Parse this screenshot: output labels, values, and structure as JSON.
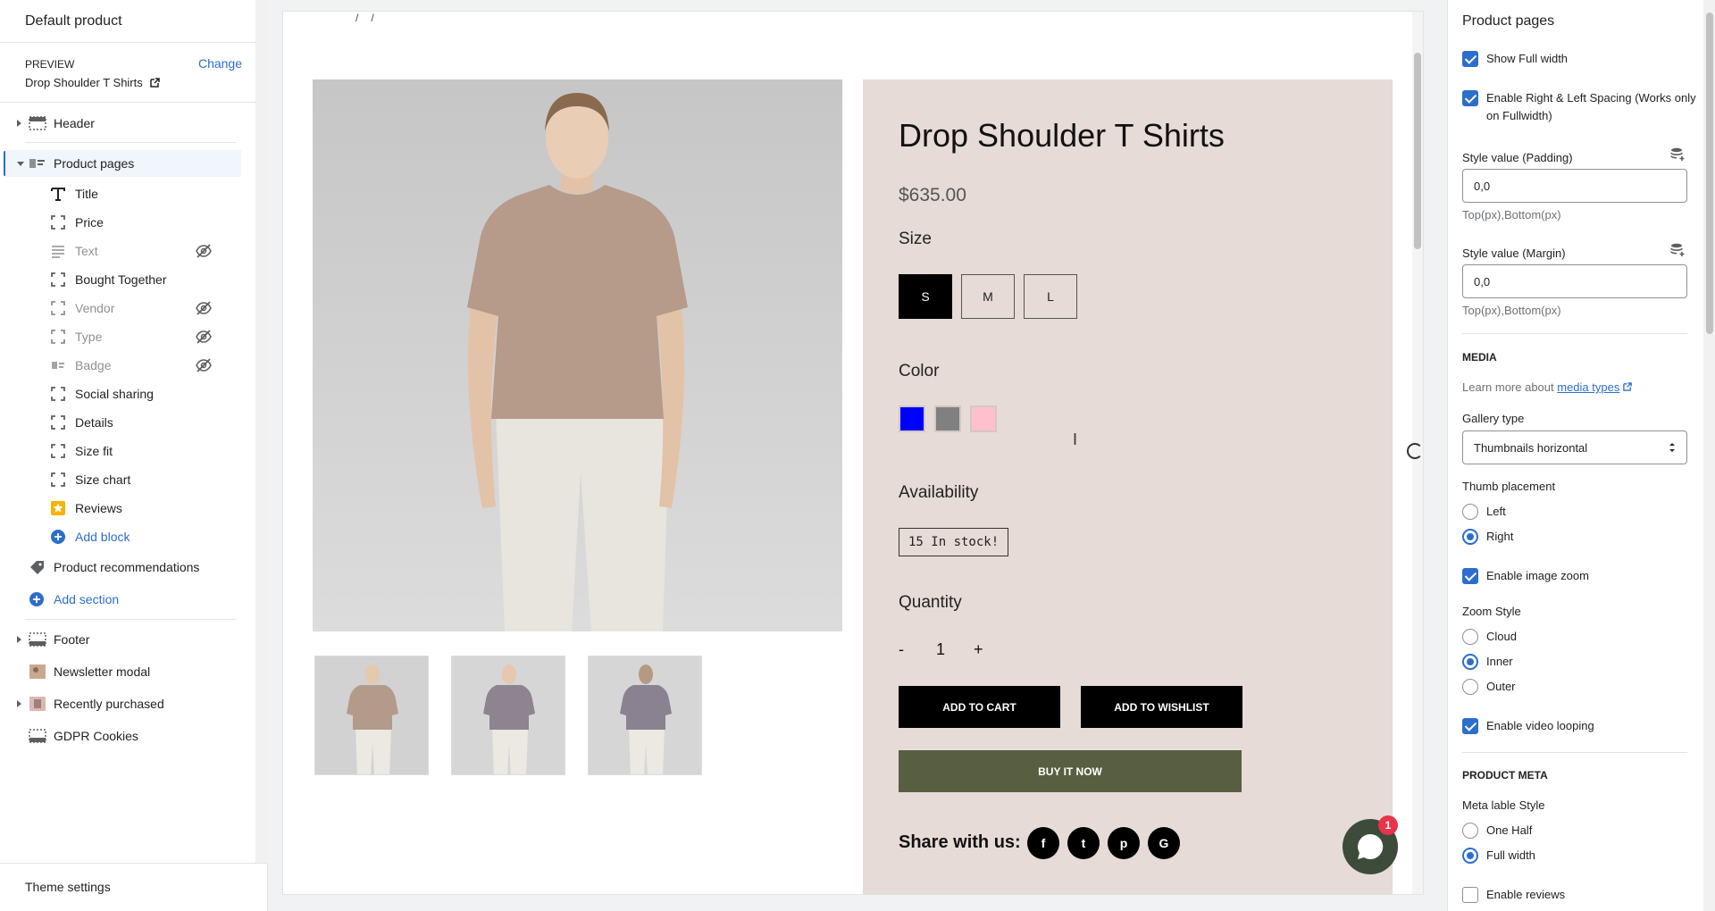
{
  "left": {
    "title": "Default product",
    "preview_label": "PREVIEW",
    "change_label": "Change",
    "preview_product": "Drop Shoulder T Shirts",
    "header_label": "Header",
    "product_pages_label": "Product pages",
    "blocks": [
      {
        "label": "Title",
        "icon": "text-icon",
        "hidden": false
      },
      {
        "label": "Price",
        "icon": "block-icon",
        "hidden": false
      },
      {
        "label": "Text",
        "icon": "paragraph-icon",
        "hidden": true
      },
      {
        "label": "Bought Together",
        "icon": "block-icon",
        "hidden": false
      },
      {
        "label": "Vendor",
        "icon": "block-icon",
        "hidden": true
      },
      {
        "label": "Type",
        "icon": "block-icon",
        "hidden": true
      },
      {
        "label": "Badge",
        "icon": "image-icon",
        "hidden": true
      },
      {
        "label": "Social sharing",
        "icon": "block-icon",
        "hidden": false
      },
      {
        "label": "Details",
        "icon": "block-icon",
        "hidden": false
      },
      {
        "label": "Size fit",
        "icon": "block-icon",
        "hidden": false
      },
      {
        "label": "Size chart",
        "icon": "block-icon",
        "hidden": false
      },
      {
        "label": "Reviews",
        "icon": "star-icon",
        "hidden": false
      }
    ],
    "add_block": "Add block",
    "product_recommendations": "Product recommendations",
    "add_section": "Add section",
    "footer": "Footer",
    "newsletter_modal": "Newsletter modal",
    "recently_purchased": "Recently purchased",
    "gdpr_cookies": "GDPR Cookies",
    "theme_settings": "Theme settings"
  },
  "preview": {
    "product_title": "Drop Shoulder T Shirts",
    "price": "$635.00",
    "size_label": "Size",
    "sizes": [
      "S",
      "M",
      "L"
    ],
    "selected_size": "S",
    "color_label": "Color",
    "colors": [
      "#0000ff",
      "#808080",
      "#ffc0cb"
    ],
    "availability_label": "Availability",
    "stock": "15 In stock!",
    "quantity_label": "Quantity",
    "qty_minus": "-",
    "qty_value": "1",
    "qty_plus": "+",
    "add_to_cart": "ADD TO CART",
    "add_to_wishlist": "ADD TO WISHLIST",
    "buy_now": "BUY IT NOW",
    "share_label": "Share with us:",
    "social": [
      "f",
      "t",
      "p",
      "G"
    ],
    "chat_badge": "1"
  },
  "right": {
    "title": "Product pages",
    "show_full_width": "Show Full width",
    "enable_spacing": "Enable Right & Left Spacing (Works only on Fullwidth)",
    "padding_label": "Style value (Padding)",
    "padding_value": "0,0",
    "padding_help": "Top(px),Bottom(px)",
    "margin_label": "Style value (Margin)",
    "margin_value": "0,0",
    "margin_help": "Top(px),Bottom(px)",
    "media_heading": "MEDIA",
    "learn_more_prefix": "Learn more about",
    "learn_more_link": "media types",
    "gallery_type_label": "Gallery type",
    "gallery_type_value": "Thumbnails horizontal",
    "thumb_placement_label": "Thumb placement",
    "thumb_left": "Left",
    "thumb_right": "Right",
    "enable_image_zoom": "Enable image zoom",
    "zoom_style_label": "Zoom Style",
    "zoom_cloud": "Cloud",
    "zoom_inner": "Inner",
    "zoom_outer": "Outer",
    "enable_video_looping": "Enable video looping",
    "product_meta_heading": "PRODUCT META",
    "meta_label_style": "Meta lable Style",
    "meta_one_half": "One Half",
    "meta_full_width": "Full width",
    "enable_reviews": "Enable reviews"
  },
  "accent": "#2c6ecb"
}
